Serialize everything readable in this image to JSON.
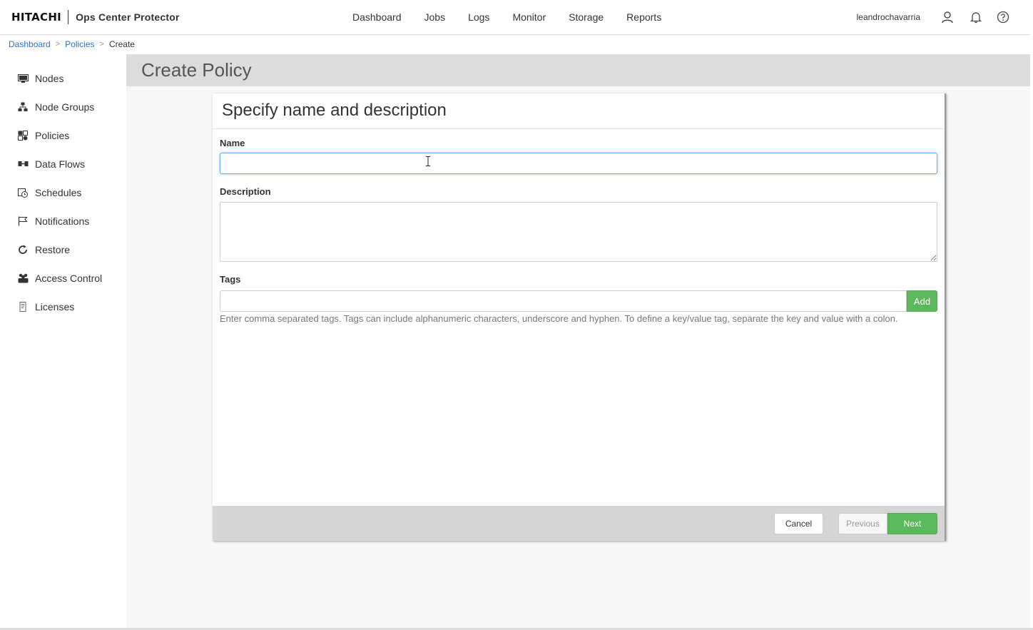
{
  "header": {
    "brand_logo": "HITACHI",
    "product": "Ops Center Protector",
    "nav": [
      "Dashboard",
      "Jobs",
      "Logs",
      "Monitor",
      "Storage",
      "Reports"
    ],
    "username": "leandrochavarria",
    "icons": [
      "user-icon",
      "bell-icon",
      "help-icon"
    ]
  },
  "breadcrumb": {
    "items": [
      "Dashboard",
      "Policies"
    ],
    "separator": ">",
    "current": "Create"
  },
  "sidebar": {
    "items": [
      {
        "label": "Nodes",
        "icon": "monitor-icon"
      },
      {
        "label": "Node Groups",
        "icon": "node-groups-icon"
      },
      {
        "label": "Policies",
        "icon": "policies-icon"
      },
      {
        "label": "Data Flows",
        "icon": "data-flows-icon"
      },
      {
        "label": "Schedules",
        "icon": "schedules-icon"
      },
      {
        "label": "Notifications",
        "icon": "flag-icon"
      },
      {
        "label": "Restore",
        "icon": "restore-icon"
      },
      {
        "label": "Access Control",
        "icon": "users-icon"
      },
      {
        "label": "Licenses",
        "icon": "license-icon"
      }
    ]
  },
  "page": {
    "title": "Create Policy"
  },
  "form": {
    "step_title": "Specify name and description",
    "name_label": "Name",
    "name_value": "",
    "description_label": "Description",
    "description_value": "",
    "tags_label": "Tags",
    "tags_value": "",
    "add_label": "Add",
    "tags_help": "Enter comma separated tags. Tags can include alphanumeric characters, underscore and hyphen. To define a key/value tag, separate the key and value with a colon."
  },
  "footer": {
    "cancel_label": "Cancel",
    "previous_label": "Previous",
    "next_label": "Next"
  },
  "colors": {
    "accent_green": "#5cb85c",
    "link_blue": "#2f74c0",
    "header_gray": "#dcdcdc"
  }
}
